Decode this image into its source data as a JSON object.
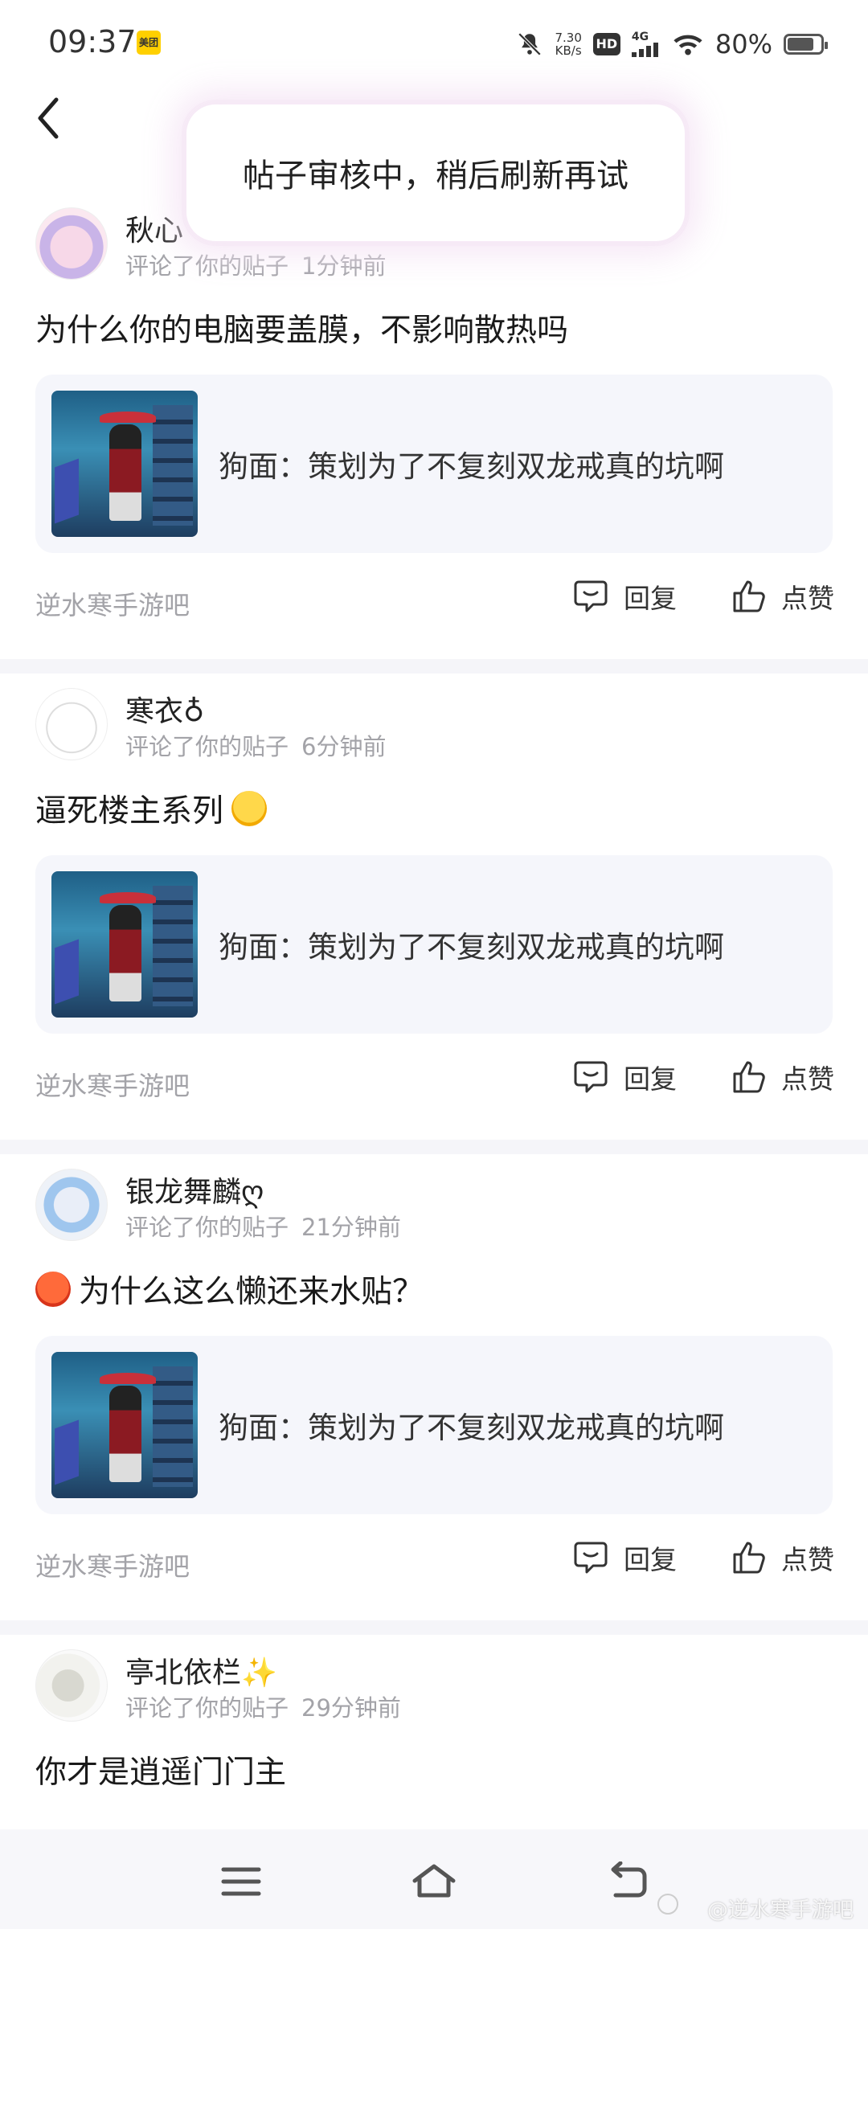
{
  "status_bar": {
    "time": "09:37",
    "app_badge": "美团",
    "net_speed_value": "7.30",
    "net_speed_unit": "KB/s",
    "hd": "HD",
    "network": "4G",
    "battery_percent": "80%",
    "battery_level": 0.8
  },
  "toast": {
    "text": "帖子审核中，稍后刷新再试"
  },
  "notifications": [
    {
      "username": "秋心",
      "action": "评论了你的贴子",
      "time": "1分钟前",
      "comment": "为什么你的电脑要盖膜，不影响散热吗",
      "post_title": "狗面：策划为了不复刻双龙戒真的坑啊",
      "forum": "逆水寒手游吧",
      "reply_label": "回复",
      "like_label": "点赞"
    },
    {
      "username": "寒衣♁",
      "action": "评论了你的贴子",
      "time": "6分钟前",
      "comment": "逼死楼主系列",
      "post_title": "狗面：策划为了不复刻双龙戒真的坑啊",
      "forum": "逆水寒手游吧",
      "reply_label": "回复",
      "like_label": "点赞"
    },
    {
      "username": "银龙舞麟ღ",
      "action": "评论了你的贴子",
      "time": "21分钟前",
      "comment": "为什么这么懒还来水贴？",
      "post_title": "狗面：策划为了不复刻双龙戒真的坑啊",
      "forum": "逆水寒手游吧",
      "reply_label": "回复",
      "like_label": "点赞"
    },
    {
      "username": "亭北依栏✨",
      "action": "评论了你的贴子",
      "time": "29分钟前",
      "comment": "你才是逍遥门门主"
    }
  ],
  "watermark": "@逆水寒手游吧"
}
